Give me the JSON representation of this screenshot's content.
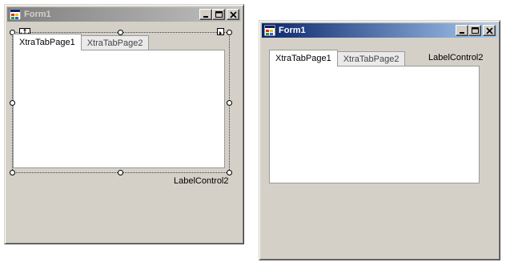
{
  "designer_form": {
    "title": "Form1",
    "tabs": [
      {
        "label": "XtraTabPage1",
        "selected": true
      },
      {
        "label": "XtraTabPage2",
        "selected": false
      }
    ],
    "label_control": "LabelControl2",
    "selection_state": "designer-selected",
    "icons": [
      "form-app-icon",
      "minimize-icon",
      "maximize-icon",
      "close-icon",
      "move-glyph-icon",
      "smart-tag-icon"
    ]
  },
  "runtime_form": {
    "title": "Form1",
    "tabs": [
      {
        "label": "XtraTabPage1",
        "selected": true
      },
      {
        "label": "XtraTabPage2",
        "selected": false
      }
    ],
    "label_control": "LabelControl2",
    "icons": [
      "form-app-icon",
      "minimize-icon",
      "maximize-icon",
      "close-icon"
    ]
  },
  "colors": {
    "form_face": "#d4d0c8",
    "active_title_start": "#0a246a",
    "active_title_end": "#a6caf0",
    "inactive_title_start": "#808080",
    "inactive_title_end": "#c0c0c0",
    "tab_border": "#9a9a9a"
  }
}
